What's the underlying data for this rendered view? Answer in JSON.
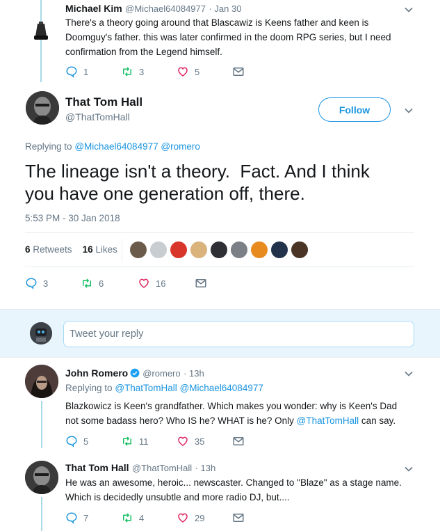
{
  "tweet1": {
    "name": "Michael Kim",
    "handle": "@Michael64084977",
    "time": "· Jan 30",
    "text_line1": "There's a theory going around that Blascawiz is Keens father and keen is",
    "text_line2": "Doomguy's father. this was later confirmed in the doom RPG series, but I need",
    "text_line3": "confirmation from the Legend himself.",
    "replies": "1",
    "retweets": "3",
    "likes": "5"
  },
  "main": {
    "name": "That Tom Hall",
    "handle": "@ThatTomHall",
    "follow_label": "Follow",
    "replying_prefix": "Replying to",
    "replying_to1": "@Michael64084977",
    "replying_to2": "@romero",
    "text_line1": "The lineage isn't a theory.  Fact. And I think",
    "text_line2": "you have one generation off, there.",
    "timestamp": "5:53 PM - 30 Jan 2018",
    "retweets_count": "6",
    "retweets_label": "Retweets",
    "likes_count": "16",
    "likes_label": "Likes",
    "replies": "3",
    "retweets": "6",
    "likes": "16"
  },
  "reply_box": {
    "placeholder": "Tweet your reply"
  },
  "tweet2": {
    "name": "John Romero",
    "handle": "@romero",
    "time": "· 13h",
    "replying_prefix": "Replying to",
    "replying_to1": "@ThatTomHall",
    "replying_to2": "@Michael64084977",
    "text_line1": "Blazkowicz is Keen's grandfather. Which makes you wonder: why is Keen's Dad",
    "text_line2a": "not some badass hero? Who IS he? WHAT is he? Only ",
    "text_line2_mention": "@ThatTomHall",
    "text_line2b": " can say.",
    "replies": "5",
    "retweets": "11",
    "likes": "35"
  },
  "tweet3": {
    "name": "That Tom Hall",
    "handle": "@ThatTomHall",
    "time": "· 13h",
    "text_line1": "He was an awesome, heroic... newscaster. Changed to \"Blaze\" as a stage name.",
    "text_line2": "Which is decidedly unsubtle and more radio DJ, but....",
    "replies": "7",
    "retweets": "4",
    "likes": "29"
  },
  "colors": {
    "accent": "#1b95e0",
    "muted": "#657786",
    "thread": "#a7dbe6",
    "verified": "#1da1f2"
  },
  "icons": [
    "reply-icon",
    "retweet-icon",
    "like-icon",
    "message-icon",
    "caret-down-icon",
    "verified-icon"
  ]
}
